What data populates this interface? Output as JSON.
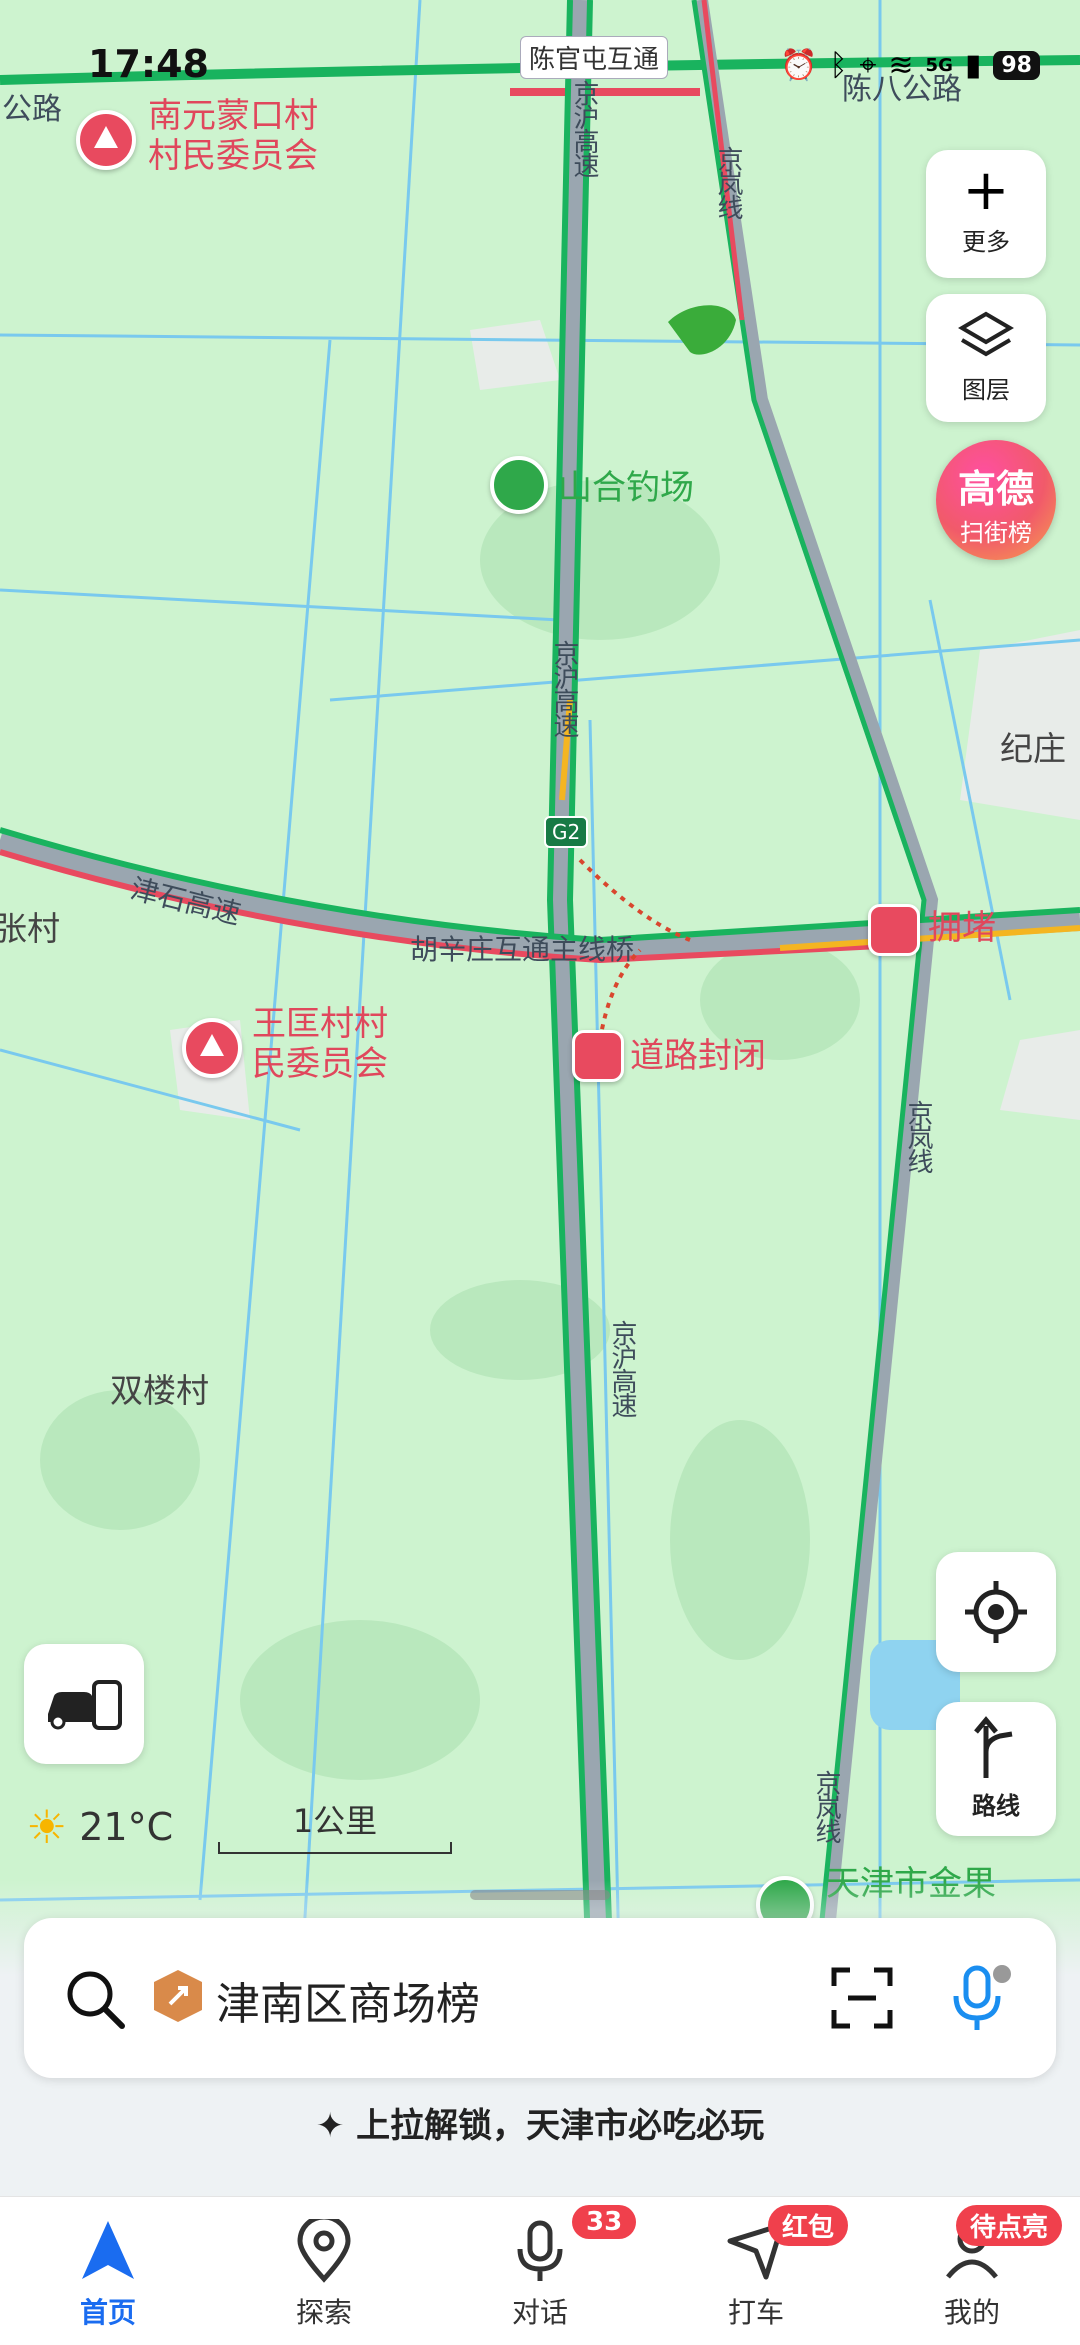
{
  "status_bar": {
    "time": "17:48",
    "network": "5G",
    "battery": "98"
  },
  "map": {
    "highway_sign": "陈官屯互通",
    "road_labels": {
      "top_left": "公路",
      "top_right": "陈八公路",
      "jinghu_1": "京沪高速",
      "jinghu_2": "京沪高速",
      "jinghu_3": "京沪高速",
      "jingfeng_1": "京岚线",
      "jingfeng_2": "京岚线",
      "jingfeng_3": "京岚线",
      "jinshi": "津石高速",
      "huxinzhuang": "胡辛庄互通主线桥",
      "shield": "G2"
    },
    "pois": {
      "nanyuan": "南元蒙口村\n村民委员会",
      "wangkuang": "王匡村村\n民委员会",
      "shanhe": "山合钓场",
      "jinguo": "天津市金果"
    },
    "places": {
      "jizhuang": "纪庄",
      "shuanglou": "双楼村",
      "left_village": "张村"
    },
    "traffic": {
      "congestion": "拥堵",
      "closed": "道路封闭"
    }
  },
  "controls": {
    "more": "更多",
    "layers": "图层",
    "gaode_badge_top": "高德",
    "gaode_badge_bottom": "扫街榜",
    "route": "路线"
  },
  "weather": {
    "temp": "21°C",
    "icon": "sun-icon"
  },
  "scale": "1公里",
  "search": {
    "text": "津南区商场榜"
  },
  "hint": "上拉解锁，天津市必吃必玩",
  "tabs": [
    {
      "label": "首页"
    },
    {
      "label": "探索"
    },
    {
      "label": "对话",
      "badge": "33"
    },
    {
      "label": "打车",
      "badge": "红包"
    },
    {
      "label": "我的",
      "badge": "待点亮"
    }
  ],
  "colors": {
    "accent": "#1a6cf0",
    "map_bg": "#cdf3cf",
    "road_green": "#19b35e",
    "road_red": "#e84a5f"
  }
}
